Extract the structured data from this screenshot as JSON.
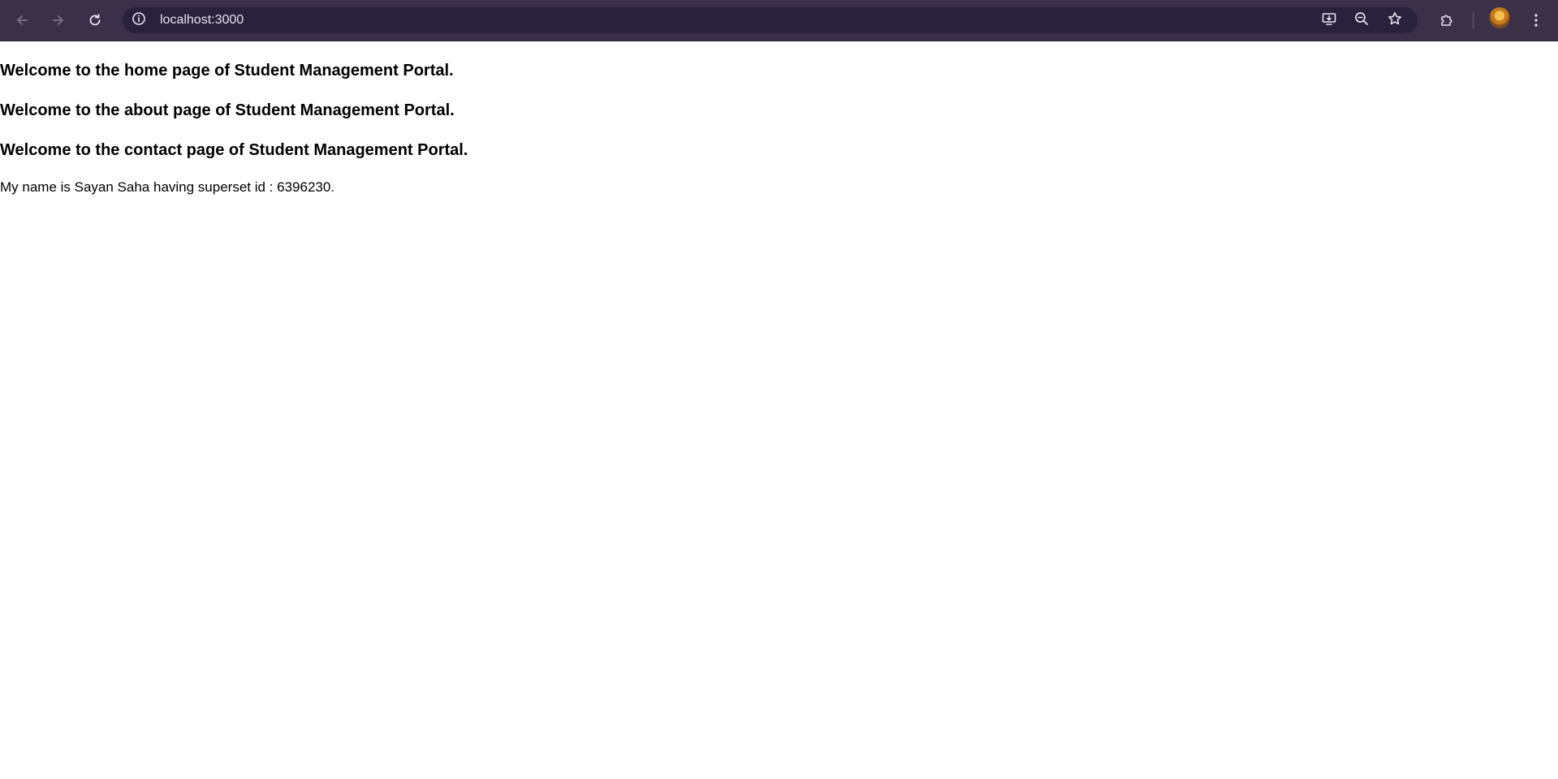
{
  "browser": {
    "url": "localhost:3000",
    "icons": {
      "back": "arrow-left-icon",
      "forward": "arrow-right-icon",
      "reload": "reload-icon",
      "site_info": "info-icon",
      "install": "install-app-icon",
      "zoom": "zoom-out-icon",
      "bookmark": "star-icon",
      "extensions": "puzzle-icon",
      "menu": "kebab-menu-icon"
    },
    "colors": {
      "toolbar": "#3a3148",
      "omnibox": "#28223a",
      "icon": "#e8e4ee",
      "icon_disabled": "#7d748c"
    }
  },
  "page": {
    "headings": [
      "Welcome to the home page of Student Management Portal.",
      "Welcome to the about page of Student Management Portal.",
      "Welcome to the contact page of Student Management Portal."
    ],
    "paragraph": "My name is Sayan Saha having superset id : 6396230."
  }
}
